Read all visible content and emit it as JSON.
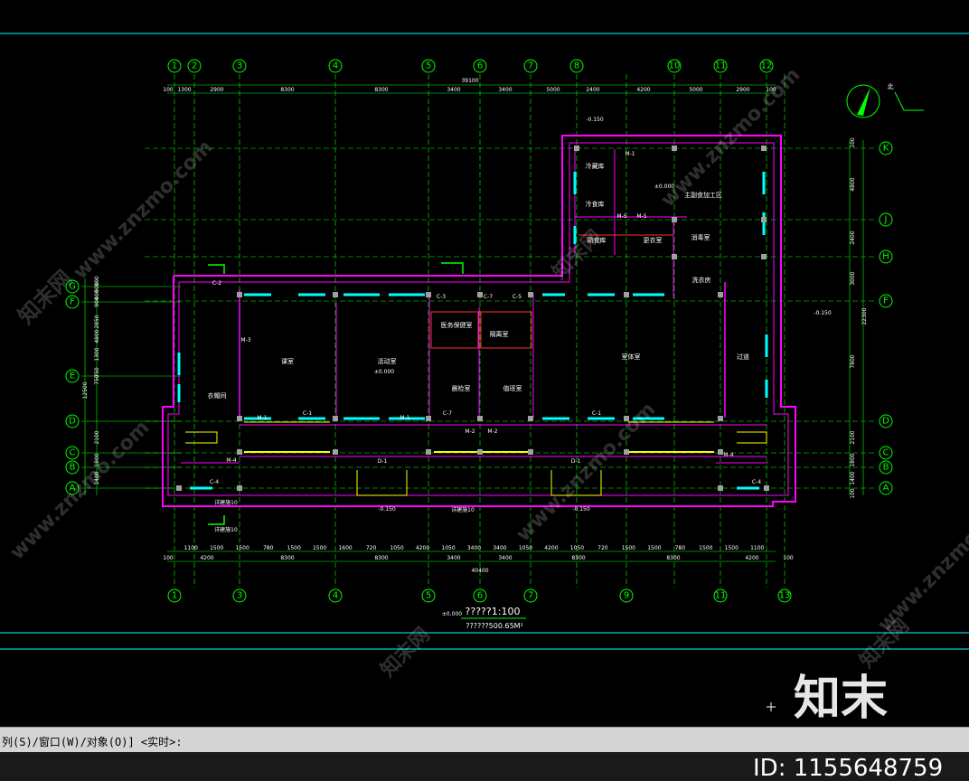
{
  "drawing": {
    "top_grid_labels": [
      "1",
      "2",
      "3",
      "4",
      "5",
      "6",
      "7",
      "8",
      "10",
      "11",
      "12"
    ],
    "bottom_grid_labels": [
      "1",
      "3",
      "4",
      "5",
      "6",
      "7",
      "9",
      "11",
      "13"
    ],
    "right_grid_labels": [
      "K",
      "J",
      "H",
      "F",
      "D",
      "C",
      "B",
      "A"
    ],
    "left_grid_labels": [
      "G",
      "F",
      "E",
      "D",
      "C",
      "B",
      "A"
    ],
    "top_overall_dim": "39100",
    "top_dims": [
      "100",
      "1300",
      "2900",
      "8300",
      "8300",
      "3400",
      "3400",
      "5000",
      "2400",
      "4200",
      "5000",
      "2900",
      "100"
    ],
    "bottom_dims_row1": [
      "1100",
      "1500",
      "1500",
      "780",
      "1500",
      "1500",
      "1600",
      "720",
      "1050",
      "4200",
      "1050",
      "3400",
      "3400",
      "1050",
      "4200",
      "1050",
      "720",
      "1500",
      "1500",
      "780",
      "1500",
      "1500",
      "1100"
    ],
    "bottom_dims_row2": [
      "100",
      "4200",
      "8300",
      "8300",
      "3400",
      "3400",
      "8300",
      "8300",
      "4200",
      "100"
    ],
    "bottom_overall_dim": "40400",
    "right_dims": [
      "100",
      "4800",
      "2400",
      "3000",
      "22300",
      "7800",
      "2100",
      "1800",
      "1400",
      "100"
    ],
    "left_dims": [
      "100",
      "500",
      "400",
      "900",
      "4800",
      "1300",
      "750",
      "750",
      "2850",
      "12500",
      "2100",
      "1800",
      "1400"
    ],
    "rooms": {
      "cold_storage": "冷藏库",
      "cold_food": "冷食库",
      "cooked_food": "熟食库",
      "main_processing": "主副食加工区",
      "changing_kitchen": "更衣室",
      "disinfection": "消毒室",
      "laundry": "洗衣房",
      "health_care": "医务保健室",
      "isolation": "隔离室",
      "classroom": "课室",
      "activity": "活动室",
      "morning_check": "晨检室",
      "duty": "值班室",
      "gym": "室体室",
      "corridor": "过道",
      "cloakroom": "衣帽间"
    },
    "elevation_tags": [
      "±0.000",
      "±0.000",
      "-0.150",
      "-0.150",
      "-0.150",
      "-0.150",
      "±0.000"
    ],
    "door_tags": [
      "M-1",
      "M-2",
      "M-3",
      "M-4",
      "M-5",
      "M-6"
    ],
    "window_tags": [
      "C-1",
      "C-2",
      "C-3",
      "C-4",
      "C-5",
      "C-6",
      "C-7",
      "D-1",
      "D-2"
    ],
    "scale_title": "?????1:100",
    "area_note": "??????500.65M²",
    "north_label": "北",
    "note_callouts": [
      "详建施10",
      "详建施10",
      "详建施10"
    ]
  },
  "command_bar": {
    "prompt": "列(S)/窗口(W)/对象(O)] <实时>:",
    "input_value": ""
  },
  "watermark": {
    "site_text": "www.znzmo.com",
    "brand_text": "知末网",
    "logo_text": "知末",
    "id_text": "ID: 1155648759"
  },
  "colors": {
    "grid_line": "#00ff00",
    "wall": "#ff00ff",
    "window": "#00ffff",
    "column": "#a0a0a0",
    "dimension": "#ffffff",
    "frame": "#00ffff",
    "stair": "#ffff00",
    "background": "#000000"
  }
}
